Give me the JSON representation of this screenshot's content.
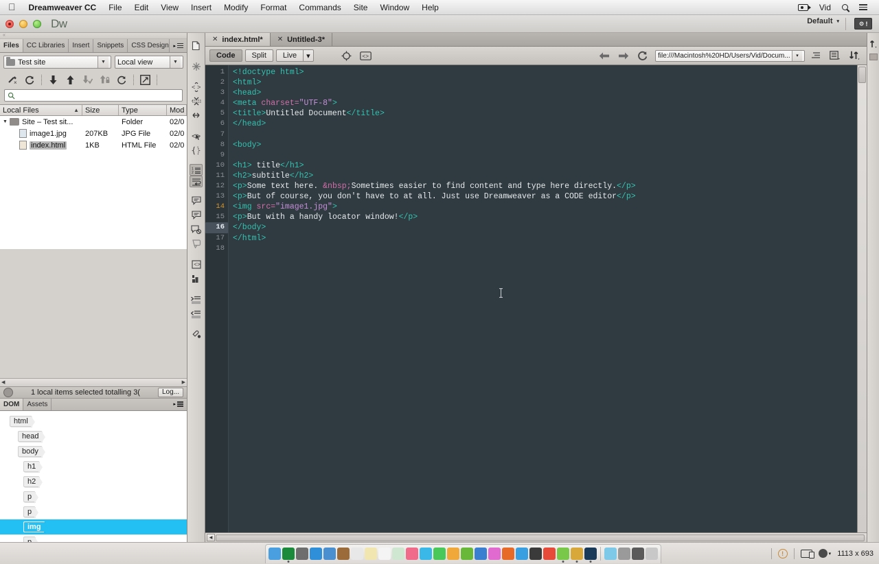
{
  "menubar": {
    "apple": "apple-logo",
    "app_name": "Dreamweaver CC",
    "items": [
      "File",
      "Edit",
      "View",
      "Insert",
      "Modify",
      "Format",
      "Commands",
      "Site",
      "Window",
      "Help"
    ],
    "right": {
      "vid_label": "Vid",
      "camera_icon": "video-camera-icon",
      "search_icon": "search-icon",
      "list_icon": "list-icon"
    }
  },
  "titlebar": {
    "app_logo": "Dw",
    "workspace": "Default",
    "workspace_caret": "▾",
    "ws_button_icon": "gear-alert-icon"
  },
  "files_panel": {
    "tabs": [
      {
        "label": "Files",
        "active": true
      },
      {
        "label": "CC Libraries",
        "active": false
      },
      {
        "label": "Insert",
        "active": false
      },
      {
        "label": "Snippets",
        "active": false
      },
      {
        "label": "CSS Designer",
        "active": false
      }
    ],
    "site_select": "Test site",
    "view_select": "Local view",
    "toolbar_icons": [
      "connect-to-remote-icon",
      "refresh-icon",
      "get-files-icon",
      "put-files-icon",
      "check-out-icon",
      "check-in-icon",
      "synchronize-icon",
      "expand-collapse-icon"
    ],
    "search_placeholder": "",
    "columns": [
      "Local Files",
      "Size",
      "Type",
      "Mod"
    ],
    "sort_caret": "▲",
    "rows": [
      {
        "name": "Site – Test sit...",
        "size": "",
        "type": "Folder",
        "modified": "02/0",
        "icon": "folder-icon",
        "indent": 0,
        "expanded": true,
        "selected": false
      },
      {
        "name": "image1.jpg",
        "size": "207KB",
        "type": "JPG File",
        "modified": "02/0",
        "icon": "jpg-file-icon",
        "indent": 1,
        "expanded": false,
        "selected": false
      },
      {
        "name": "index.html",
        "size": "1KB",
        "type": "HTML File",
        "modified": "02/0",
        "icon": "html-file-icon",
        "indent": 1,
        "expanded": false,
        "selected": true
      }
    ],
    "status_text": "1 local items selected totalling 3(",
    "log_button": "Log..."
  },
  "dom_panel": {
    "tabs": [
      {
        "label": "DOM",
        "active": true
      },
      {
        "label": "Assets",
        "active": false
      }
    ],
    "nodes": [
      {
        "tag": "html",
        "indent": 0,
        "selected": false
      },
      {
        "tag": "head",
        "indent": 1,
        "selected": false
      },
      {
        "tag": "body",
        "indent": 1,
        "selected": false
      },
      {
        "tag": "h1",
        "indent": 2,
        "selected": false
      },
      {
        "tag": "h2",
        "indent": 2,
        "selected": false
      },
      {
        "tag": "p",
        "indent": 2,
        "selected": false
      },
      {
        "tag": "p",
        "indent": 2,
        "selected": false
      },
      {
        "tag": "img",
        "indent": 2,
        "selected": true
      },
      {
        "tag": "p",
        "indent": 2,
        "selected": false
      }
    ],
    "selection_color": "#22c0f3"
  },
  "vertical_toolbar": {
    "icons": [
      "open-documents-icon",
      "collapse-full-tag-icon",
      "expand-all-icon",
      "select-parent-tag-icon",
      "balance-braces-icon",
      "line-numbers-icon",
      "word-wrap-icon",
      "apply-comment-icon",
      "remove-comment-icon",
      "highlight-invalid-code-icon",
      "syntax-error-alert-icon",
      "apply-source-formatting-icon",
      "indent-code-icon",
      "outdent-code-icon",
      "format-source-code-icon"
    ]
  },
  "document_tabs": [
    {
      "label": "index.html*",
      "active": true,
      "close_icon": "close-icon"
    },
    {
      "label": "Untitled-3*",
      "active": false,
      "close_icon": "close-icon"
    }
  ],
  "document_toolbar": {
    "view_buttons": [
      {
        "label": "Code",
        "active": true
      },
      {
        "label": "Split",
        "active": false
      },
      {
        "label": "Live",
        "active": false
      }
    ],
    "live_caret": "▾",
    "icons": [
      "live-view-options-icon",
      "inspect-code-icon"
    ],
    "nav_back_icon": "arrow-left-icon",
    "nav_forward_icon": "arrow-right-icon",
    "refresh_icon": "refresh-icon",
    "url": "file:///Macintosh%20HD/Users/Vid/Docum...",
    "url_caret": "▾",
    "right_icons": [
      "file-management-icon",
      "visual-aids-icon",
      "sort-icon"
    ]
  },
  "code_editor": {
    "current_line": 16,
    "marked_line": 14,
    "lines": [
      {
        "n": 1,
        "tokens": [
          {
            "t": "tag",
            "v": "<!doctype html>"
          }
        ]
      },
      {
        "n": 2,
        "tokens": [
          {
            "t": "tag",
            "v": "<html>"
          }
        ]
      },
      {
        "n": 3,
        "tokens": [
          {
            "t": "tag",
            "v": "<head>"
          }
        ]
      },
      {
        "n": 4,
        "tokens": [
          {
            "t": "tag",
            "v": "<meta "
          },
          {
            "t": "attr",
            "v": "charset="
          },
          {
            "t": "val",
            "v": "\"UTF-8\""
          },
          {
            "t": "tag",
            "v": ">"
          }
        ]
      },
      {
        "n": 5,
        "tokens": [
          {
            "t": "tag",
            "v": "<title>"
          },
          {
            "t": "txt",
            "v": "Untitled Document"
          },
          {
            "t": "tag",
            "v": "</title>"
          }
        ]
      },
      {
        "n": 6,
        "tokens": [
          {
            "t": "tag",
            "v": "</head>"
          }
        ]
      },
      {
        "n": 7,
        "tokens": []
      },
      {
        "n": 8,
        "tokens": [
          {
            "t": "tag",
            "v": "<body>"
          }
        ]
      },
      {
        "n": 9,
        "tokens": []
      },
      {
        "n": 10,
        "tokens": [
          {
            "t": "tag",
            "v": "<h1>"
          },
          {
            "t": "txt",
            "v": " title"
          },
          {
            "t": "tag",
            "v": "</h1>"
          }
        ]
      },
      {
        "n": 11,
        "tokens": [
          {
            "t": "tag",
            "v": "<h2>"
          },
          {
            "t": "txt",
            "v": "subtitle"
          },
          {
            "t": "tag",
            "v": "</h2>"
          }
        ]
      },
      {
        "n": 12,
        "tokens": [
          {
            "t": "tag",
            "v": "<p>"
          },
          {
            "t": "txt",
            "v": "Some text here. "
          },
          {
            "t": "ent",
            "v": "&nbsp;"
          },
          {
            "t": "txt",
            "v": "Sometimes easier to find content and type here directly."
          },
          {
            "t": "tag",
            "v": "</p>"
          }
        ]
      },
      {
        "n": 13,
        "tokens": [
          {
            "t": "tag",
            "v": "<p>"
          },
          {
            "t": "txt",
            "v": "But of course, you don't have to at all. Just use Dreamweaver as a CODE editor"
          },
          {
            "t": "tag",
            "v": "</p>"
          }
        ]
      },
      {
        "n": 14,
        "tokens": [
          {
            "t": "tag",
            "v": "<img "
          },
          {
            "t": "attr",
            "v": "src="
          },
          {
            "t": "val",
            "v": "\"image1.jpg\""
          },
          {
            "t": "tag",
            "v": ">"
          }
        ]
      },
      {
        "n": 15,
        "tokens": [
          {
            "t": "tag",
            "v": "<p>"
          },
          {
            "t": "txt",
            "v": "But with a handy locator window!"
          },
          {
            "t": "tag",
            "v": "</p>"
          }
        ]
      },
      {
        "n": 16,
        "tokens": [
          {
            "t": "tag",
            "v": "</body>"
          }
        ]
      },
      {
        "n": 17,
        "tokens": [
          {
            "t": "tag",
            "v": "</html>"
          }
        ]
      },
      {
        "n": 18,
        "tokens": []
      }
    ],
    "colors": {
      "background": "#303b41",
      "gutter": "#2b3439",
      "tag": "#33c2b0",
      "attribute": "#d06fa8",
      "value": "#c58fd8",
      "text": "#e6eaec",
      "line_number": "#8b9196",
      "current_line_highlight": "#48525c",
      "marked_line_number": "#d9972f"
    }
  },
  "status_bar": {
    "warning_icon": "warning-icon",
    "device_icon": "device-preview-icon",
    "globe_icon": "real-time-preview-icon",
    "window_size": "1113 x 693"
  },
  "dock": {
    "items": [
      {
        "name": "finder-icon",
        "color": "#4a9fe0"
      },
      {
        "name": "dreamweaver-icon",
        "color": "#1b8a3a",
        "running": true
      },
      {
        "name": "system-preferences-icon",
        "color": "#6e6e6e"
      },
      {
        "name": "safari-icon",
        "color": "#2f8fd8"
      },
      {
        "name": "mail-icon",
        "color": "#4a8fd0"
      },
      {
        "name": "contacts-icon",
        "color": "#9c6b3a"
      },
      {
        "name": "calendar-icon",
        "color": "#e8e8e8"
      },
      {
        "name": "notes-icon",
        "color": "#f2e6b0"
      },
      {
        "name": "reminders-icon",
        "color": "#f4f4f4"
      },
      {
        "name": "maps-icon",
        "color": "#cfe7d0"
      },
      {
        "name": "photos-icon",
        "color": "#f06a8a"
      },
      {
        "name": "messages-icon",
        "color": "#3ab8e8"
      },
      {
        "name": "facetime-icon",
        "color": "#4ac85a"
      },
      {
        "name": "pages-icon",
        "color": "#f0a83a"
      },
      {
        "name": "numbers-icon",
        "color": "#6ab83a"
      },
      {
        "name": "keynote-icon",
        "color": "#3a7fd0"
      },
      {
        "name": "itunes-icon",
        "color": "#e06ad0"
      },
      {
        "name": "firefox-icon",
        "color": "#e86a28"
      },
      {
        "name": "app-store-icon",
        "color": "#3a9fe0"
      },
      {
        "name": "screenflow-icon",
        "color": "#3a3a3a"
      },
      {
        "name": "chrome-icon",
        "color": "#e84a3a"
      },
      {
        "name": "evernote-icon",
        "color": "#7ac84a",
        "running": true
      },
      {
        "name": "illustrator-icon",
        "color": "#d8a83a",
        "running": true
      },
      {
        "name": "photoshop-icon",
        "color": "#1a3a5a",
        "running": true
      }
    ],
    "right_items": [
      {
        "name": "downloads-stack-icon",
        "color": "#7ec8e8"
      },
      {
        "name": "screen-sharing-icon",
        "color": "#9a9a9a"
      },
      {
        "name": "display-icon",
        "color": "#5a5a5a"
      },
      {
        "name": "trash-icon",
        "color": "#c8c8c8"
      }
    ]
  }
}
